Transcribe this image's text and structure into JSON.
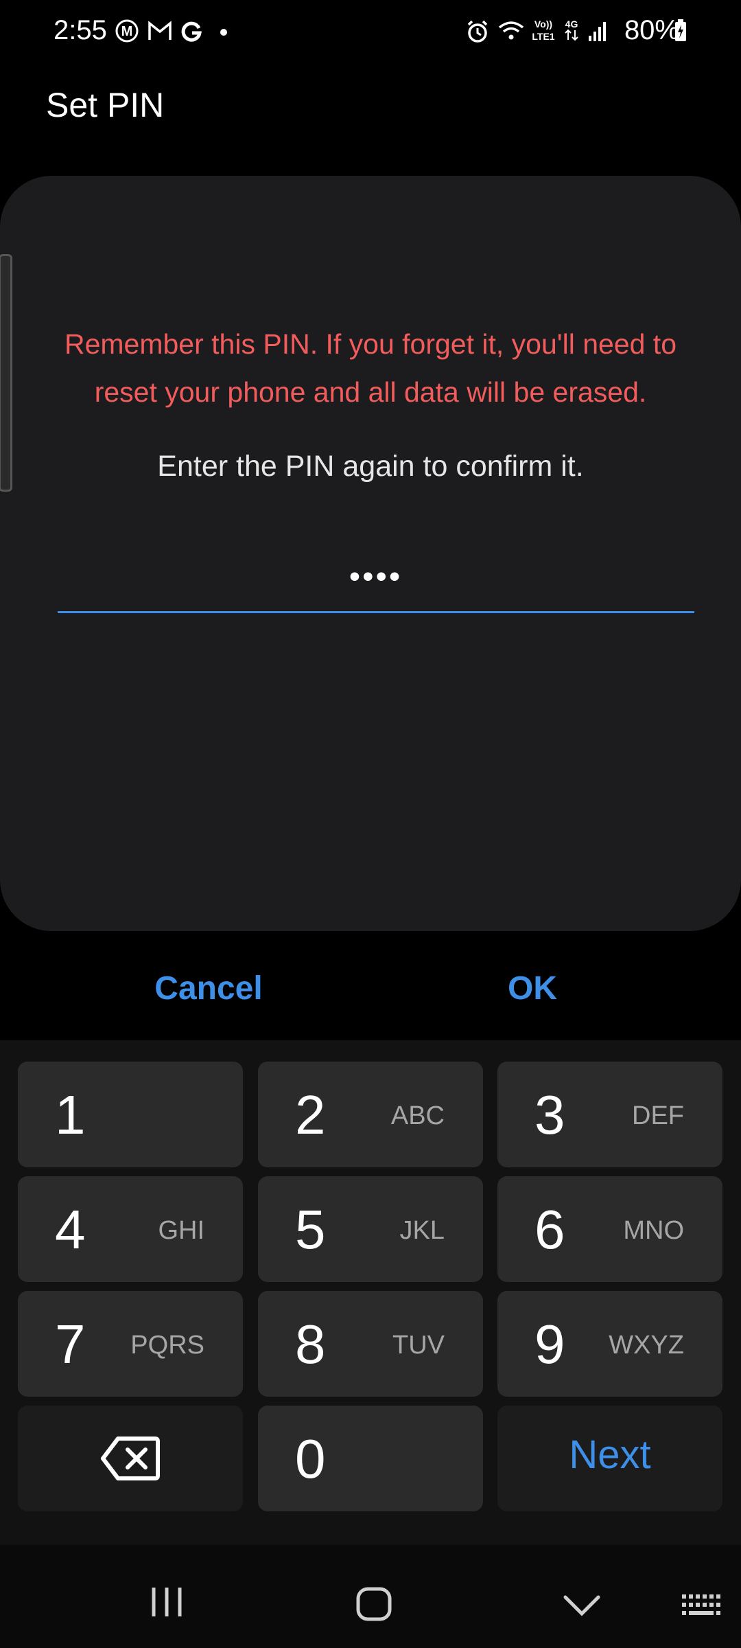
{
  "status_bar": {
    "time": "2:55",
    "battery": "80%",
    "icons": [
      "m-circle-icon",
      "gmail-icon",
      "google-icon",
      "dot-icon",
      "alarm-icon",
      "wifi-icon",
      "volte-icon",
      "4g-icon",
      "signal-icon",
      "battery-charging-icon"
    ]
  },
  "title": "Set PIN",
  "warning": "Remember this PIN. If you forget it, you'll need to reset your phone and all data will be erased.",
  "instruction": "Enter the PIN again to confirm it.",
  "pin_value": "••••",
  "buttons": {
    "cancel": "Cancel",
    "ok": "OK"
  },
  "keypad": {
    "keys": [
      {
        "num": "1",
        "letters": ""
      },
      {
        "num": "2",
        "letters": "ABC"
      },
      {
        "num": "3",
        "letters": "DEF"
      },
      {
        "num": "4",
        "letters": "GHI"
      },
      {
        "num": "5",
        "letters": "JKL"
      },
      {
        "num": "6",
        "letters": "MNO"
      },
      {
        "num": "7",
        "letters": "PQRS"
      },
      {
        "num": "8",
        "letters": "TUV"
      },
      {
        "num": "9",
        "letters": "WXYZ"
      },
      {
        "num": "0",
        "letters": ""
      }
    ],
    "next": "Next"
  },
  "colors": {
    "accent": "#3e8fe8",
    "warning": "#f25c5c",
    "card": "#1c1c1e"
  }
}
